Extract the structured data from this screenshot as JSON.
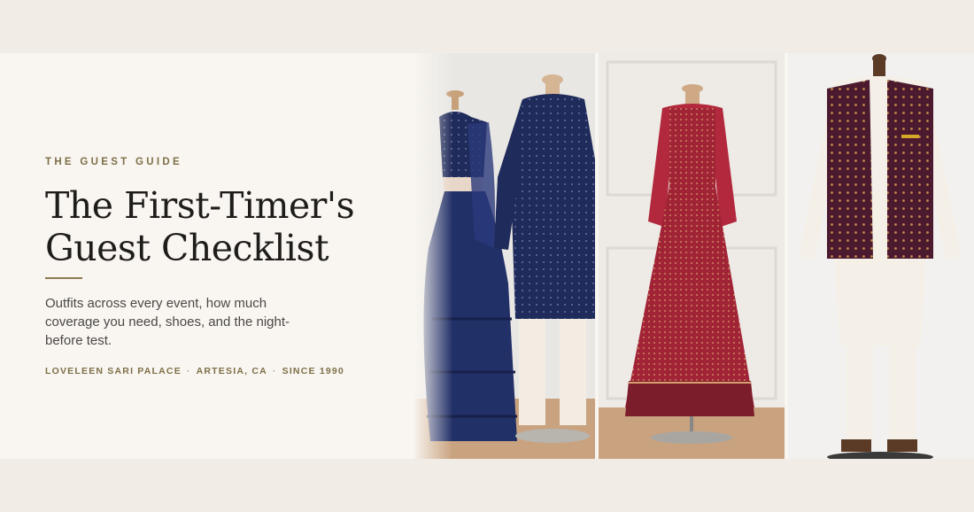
{
  "hero": {
    "eyebrow": "THE GUEST GUIDE",
    "title_line1": "The First-Timer's",
    "title_line2": "Guest Checklist",
    "subtitle": "Outfits across every event, how much coverage you need, shoes, and the night-before test.",
    "byline": {
      "store": "LOVELEEN SARI PALACE",
      "location": "ARTESIA, CA",
      "since": "SINCE 1990",
      "separator": "·"
    }
  },
  "photos": [
    {
      "subject": "navy lehenga saree and navy kurta on mannequins",
      "icon": "saree-and-kurta-photo"
    },
    {
      "subject": "red embroidered anarkali on stand",
      "icon": "anarkali-photo"
    },
    {
      "subject": "maroon nehru jacket over ivory kurta pajama",
      "icon": "nehru-jacket-photo"
    }
  ],
  "colors": {
    "page_bg": "#f1ede6",
    "panel_bg": "#f9f6f1",
    "accent_gold": "#7d6f47",
    "title_ink": "#1f1d1a",
    "navy": "#1f2b5a",
    "ruby": "#a12436",
    "maroon": "#4b1a2e"
  }
}
